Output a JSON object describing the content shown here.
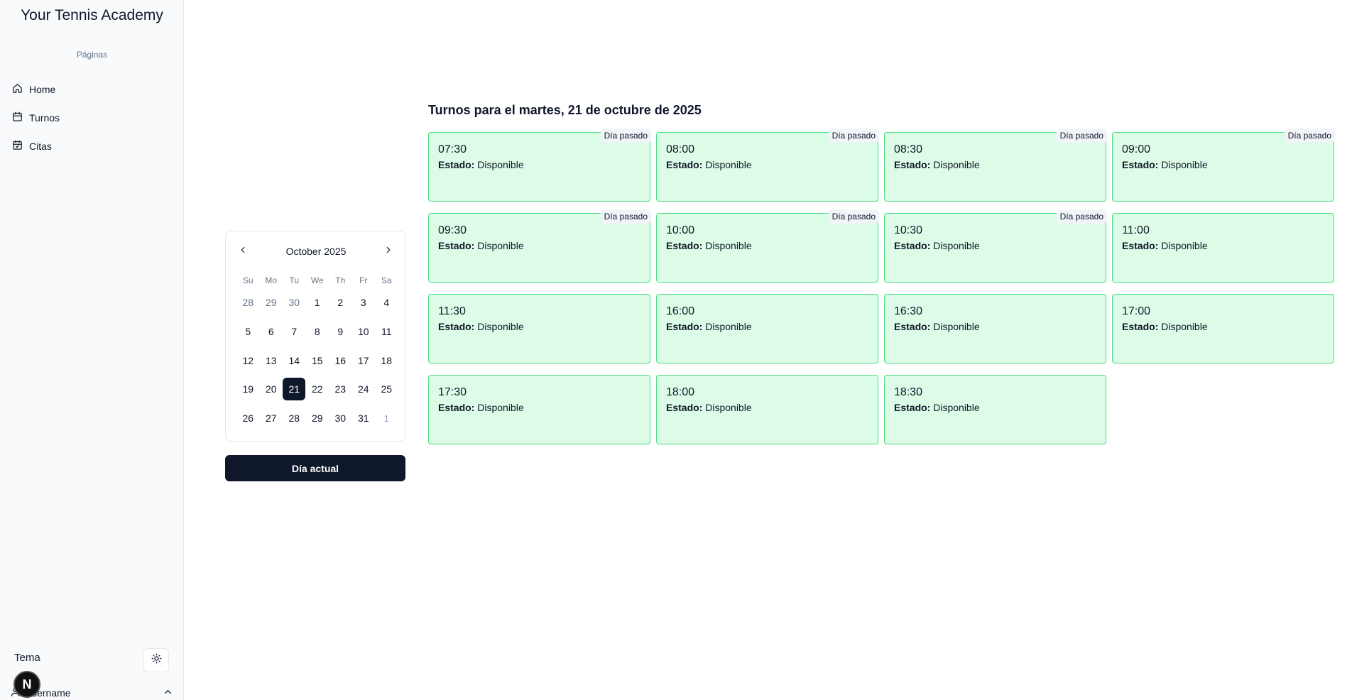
{
  "sidebar": {
    "brand": "Your Tennis Academy",
    "section_label": "Páginas",
    "items": [
      {
        "label": "Home",
        "icon": "home-icon"
      },
      {
        "label": "Turnos",
        "icon": "calendar-icon"
      },
      {
        "label": "Citas",
        "icon": "calendar-check-icon"
      }
    ],
    "theme_label": "Tema",
    "theme_icon": "sun-icon",
    "user": {
      "avatar_initial": "N",
      "name": "Username"
    }
  },
  "calendar": {
    "month_label": "October 2025",
    "weekdays": [
      "Su",
      "Mo",
      "Tu",
      "We",
      "Th",
      "Fr",
      "Sa"
    ],
    "weeks": [
      [
        "28",
        "29",
        "30",
        "1",
        "2",
        "3",
        "4"
      ],
      [
        "5",
        "6",
        "7",
        "8",
        "9",
        "10",
        "11"
      ],
      [
        "12",
        "13",
        "14",
        "15",
        "16",
        "17",
        "18"
      ],
      [
        "19",
        "20",
        "21",
        "22",
        "23",
        "24",
        "25"
      ],
      [
        "26",
        "27",
        "28",
        "29",
        "30",
        "31",
        "1"
      ]
    ],
    "selected": "21",
    "today_button": "Día actual"
  },
  "slots": {
    "title": "Turnos para el martes, 21 de octubre de 2025",
    "status_label": "Estado:",
    "past_label": "Día pasado",
    "items": [
      {
        "time": "07:30",
        "status": "Disponible",
        "past": true
      },
      {
        "time": "08:00",
        "status": "Disponible",
        "past": true
      },
      {
        "time": "08:30",
        "status": "Disponible",
        "past": true
      },
      {
        "time": "09:00",
        "status": "Disponible",
        "past": true
      },
      {
        "time": "09:30",
        "status": "Disponible",
        "past": true
      },
      {
        "time": "10:00",
        "status": "Disponible",
        "past": true
      },
      {
        "time": "10:30",
        "status": "Disponible",
        "past": true
      },
      {
        "time": "11:00",
        "status": "Disponible",
        "past": false
      },
      {
        "time": "11:30",
        "status": "Disponible",
        "past": false
      },
      {
        "time": "16:00",
        "status": "Disponible",
        "past": false
      },
      {
        "time": "16:30",
        "status": "Disponible",
        "past": false
      },
      {
        "time": "17:00",
        "status": "Disponible",
        "past": false
      },
      {
        "time": "17:30",
        "status": "Disponible",
        "past": false
      },
      {
        "time": "18:00",
        "status": "Disponible",
        "past": false
      },
      {
        "time": "18:30",
        "status": "Disponible",
        "past": false
      }
    ]
  },
  "colors": {
    "primary": "#0f172a",
    "slot_bg": "#dcfce7",
    "slot_border": "#4ade80"
  }
}
